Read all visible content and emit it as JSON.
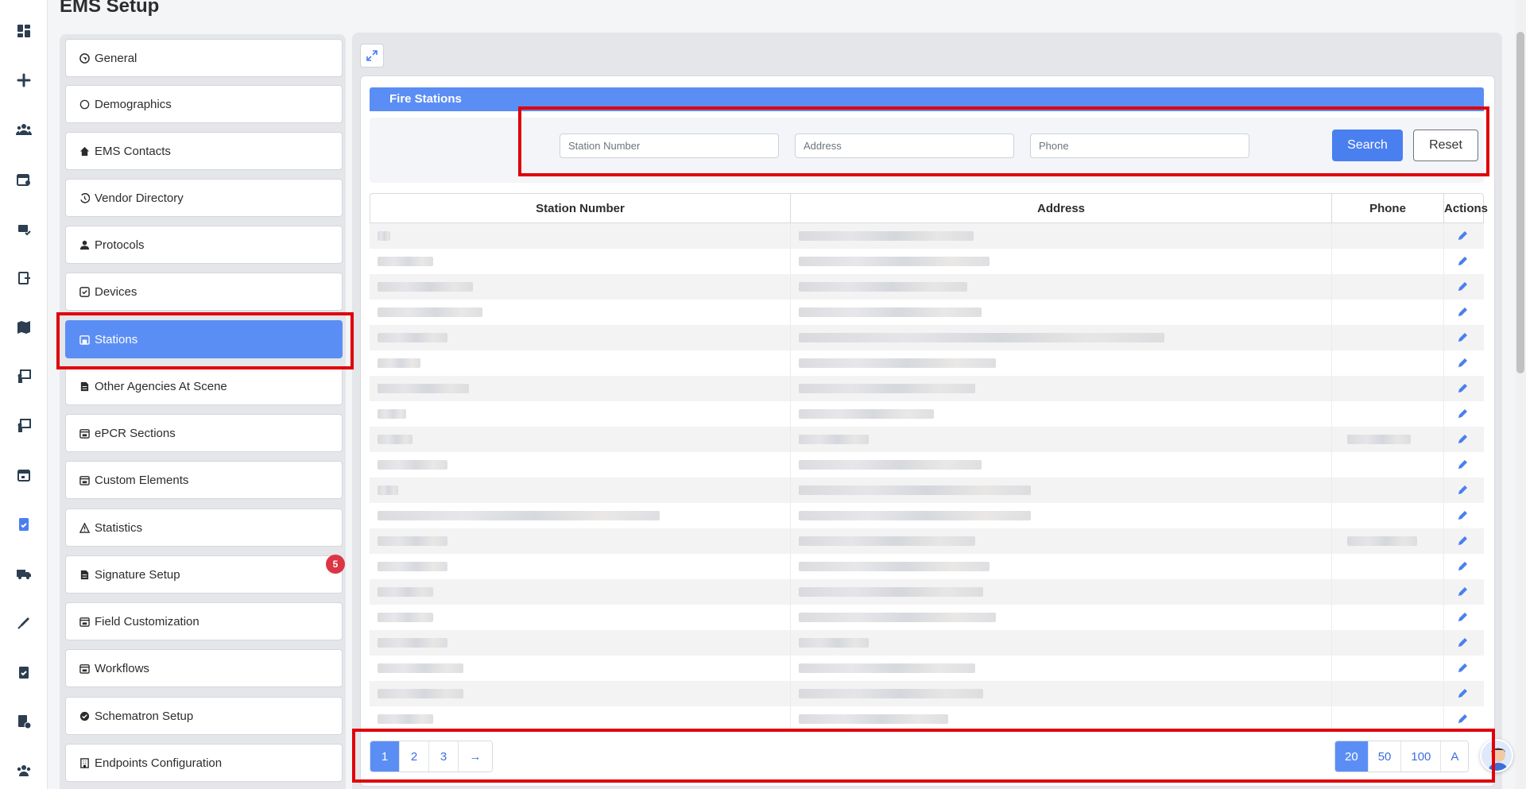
{
  "page": {
    "title": "EMS Setup"
  },
  "rail": {
    "icons": [
      "dashboard-icon",
      "plus-icon",
      "users-icon",
      "calendar-user-icon",
      "mail-check-icon",
      "file-export-icon",
      "map-icon",
      "chalkboard-icon",
      "chalkboard-icon",
      "calendar-icon",
      "file-check-icon",
      "truck-icon",
      "syringe-icon",
      "clipboard-check-icon",
      "file-info-icon",
      "team-icon"
    ]
  },
  "sidebar": {
    "items": [
      {
        "label": "General",
        "icon": "globe-icon"
      },
      {
        "label": "Demographics",
        "icon": "circle-icon"
      },
      {
        "label": "EMS Contacts",
        "icon": "home-icon"
      },
      {
        "label": "Vendor Directory",
        "icon": "history-icon"
      },
      {
        "label": "Protocols",
        "icon": "user-icon"
      },
      {
        "label": "Devices",
        "icon": "checkbox-icon"
      },
      {
        "label": "Stations",
        "icon": "station-icon",
        "active": true
      },
      {
        "label": "Other Agencies At Scene",
        "icon": "document-icon"
      },
      {
        "label": "ePCR Sections",
        "icon": "panel-icon"
      },
      {
        "label": "Custom Elements",
        "icon": "panel-icon"
      },
      {
        "label": "Statistics",
        "icon": "warning-icon"
      },
      {
        "label": "Signature Setup",
        "icon": "document-icon"
      },
      {
        "label": "Field Customization",
        "icon": "panel-icon"
      },
      {
        "label": "Workflows",
        "icon": "panel-icon"
      },
      {
        "label": "Schematron Setup",
        "icon": "badge-check-icon"
      },
      {
        "label": "Endpoints Configuration",
        "icon": "building-icon"
      }
    ],
    "badge": "5"
  },
  "main": {
    "section_title": "Fire Stations",
    "filters": {
      "station_number_placeholder": "Station Number",
      "address_placeholder": "Address",
      "phone_placeholder": "Phone",
      "search_label": "Search",
      "reset_label": "Reset"
    },
    "table": {
      "columns": [
        "Station Number",
        "Address",
        "Phone",
        "Actions"
      ],
      "row_count": 20,
      "row_action": "edit-icon"
    },
    "pagination": {
      "pages": [
        "1",
        "2",
        "3",
        "→"
      ],
      "current_page": "1",
      "page_sizes": [
        "20",
        "50",
        "100",
        "A"
      ],
      "current_size": "20"
    }
  },
  "colors": {
    "accent": "#5b8ef5",
    "highlight": "#e0000b",
    "badge": "#dc3545"
  }
}
